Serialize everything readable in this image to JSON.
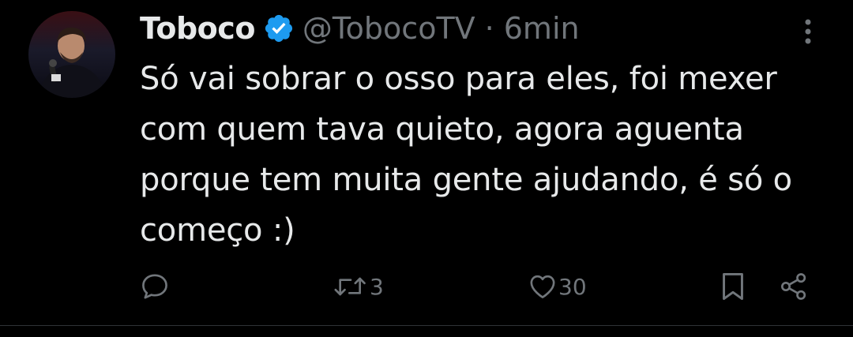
{
  "tweet": {
    "author": {
      "name": "Toboco",
      "handle": "@TobocoTV",
      "verified": true
    },
    "separator": "·",
    "time": "6min",
    "text": "Só vai sobrar o osso para eles, foi mexer com quem tava quieto, agora aguenta porque tem muita gente ajudando, é só o começo :)",
    "actions": {
      "reply": {
        "icon": "reply-icon",
        "count": ""
      },
      "retweet": {
        "icon": "retweet-icon",
        "count": "3"
      },
      "like": {
        "icon": "heart-icon",
        "count": "30"
      },
      "bookmark": {
        "icon": "bookmark-icon"
      },
      "share": {
        "icon": "share-icon"
      }
    }
  },
  "colors": {
    "background": "#000000",
    "text_primary": "#e7e9ea",
    "text_secondary": "#71767b",
    "verified_badge": "#1d9bf0",
    "divider": "#2f3336"
  }
}
